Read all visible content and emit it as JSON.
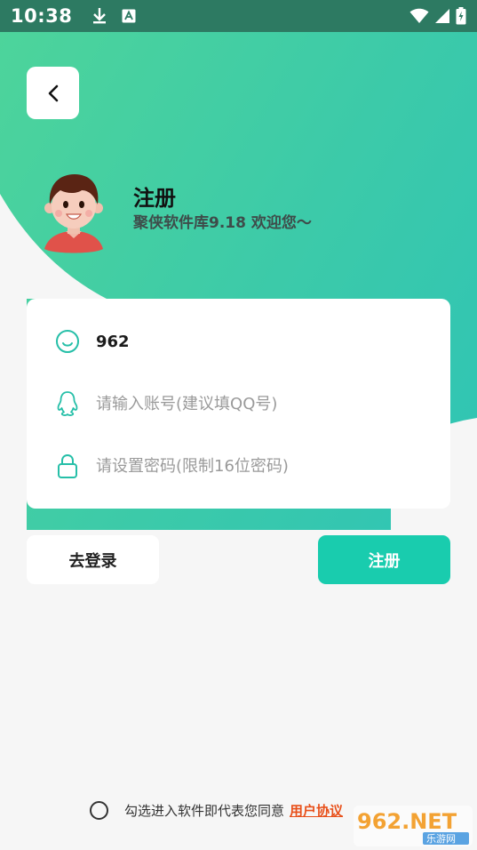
{
  "status_bar": {
    "time": "10:38",
    "left_icons": [
      "download-icon",
      "keyboard-a-icon"
    ],
    "right_icons": [
      "wifi-icon",
      "signal-icon",
      "battery-charging-icon"
    ]
  },
  "header": {
    "back_icon": "chevron-left-icon",
    "title": "注册",
    "subtitle": "聚侠软件库9.18 欢迎您～"
  },
  "form": {
    "nickname": {
      "icon": "smile-icon",
      "value": "962"
    },
    "account": {
      "icon": "qq-penguin-icon",
      "value": "",
      "placeholder": "请输入账号(建议填QQ号)"
    },
    "password": {
      "icon": "lock-icon",
      "value": "",
      "placeholder": "请设置密码(限制16位密码)"
    }
  },
  "buttons": {
    "login_label": "去登录",
    "register_label": "注册"
  },
  "agreement": {
    "checked": false,
    "text": "勾选进入软件即代表您同意",
    "link_label": "用户协议"
  },
  "watermark": {
    "brand": "962.NET",
    "sub": "乐游网"
  },
  "colors": {
    "accent": "#19ccae",
    "gradient_start": "#4dd49b",
    "gradient_end": "#2fc4b5",
    "status_bar": "#2d7a62",
    "link": "#e8501a",
    "icon_teal": "#26bfa8"
  }
}
